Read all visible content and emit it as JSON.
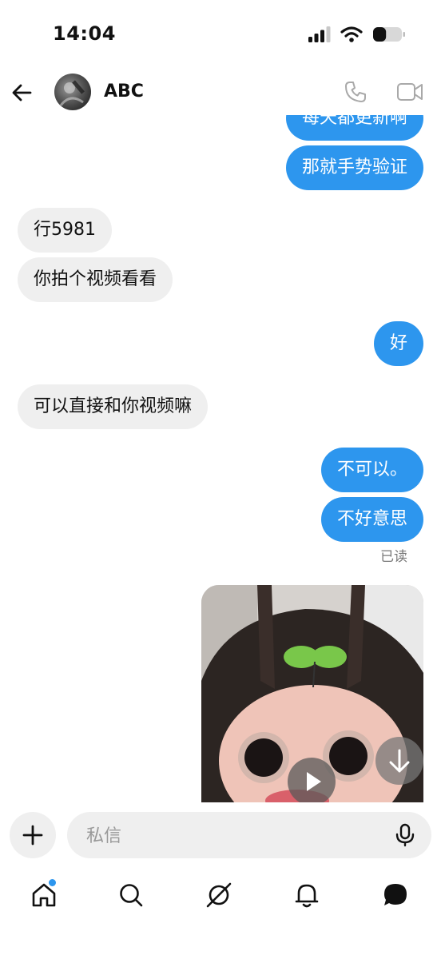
{
  "status_bar": {
    "time": "14:04",
    "battery_level": 0.45
  },
  "header": {
    "contact_name": "ABC"
  },
  "messages": [
    {
      "side": "out",
      "text": "每天都更新啊"
    },
    {
      "side": "out",
      "text": "那就手势验证"
    },
    {
      "side": "in",
      "text": "行5981"
    },
    {
      "side": "in",
      "text": "你拍个视频看看"
    },
    {
      "side": "out",
      "text": "好"
    },
    {
      "side": "in",
      "text": "可以直接和你视频嘛"
    },
    {
      "side": "out",
      "text": "不可以。"
    },
    {
      "side": "out",
      "text": "不好意思"
    }
  ],
  "read_receipt": "已读",
  "composer": {
    "placeholder": "私信"
  },
  "icons": {
    "back": "arrow-left-icon",
    "call": "phone-icon",
    "video": "video-camera-icon",
    "add": "plus-icon",
    "mic": "microphone-icon",
    "download": "download-arrow-icon",
    "play": "play-icon",
    "tabs": [
      "home-icon",
      "search-icon",
      "explore-compass-icon",
      "bell-icon",
      "chat-bubble-icon"
    ]
  },
  "colors": {
    "accent": "#2d96ee",
    "incoming_bubble": "#efefef",
    "background": "#ffffff"
  }
}
